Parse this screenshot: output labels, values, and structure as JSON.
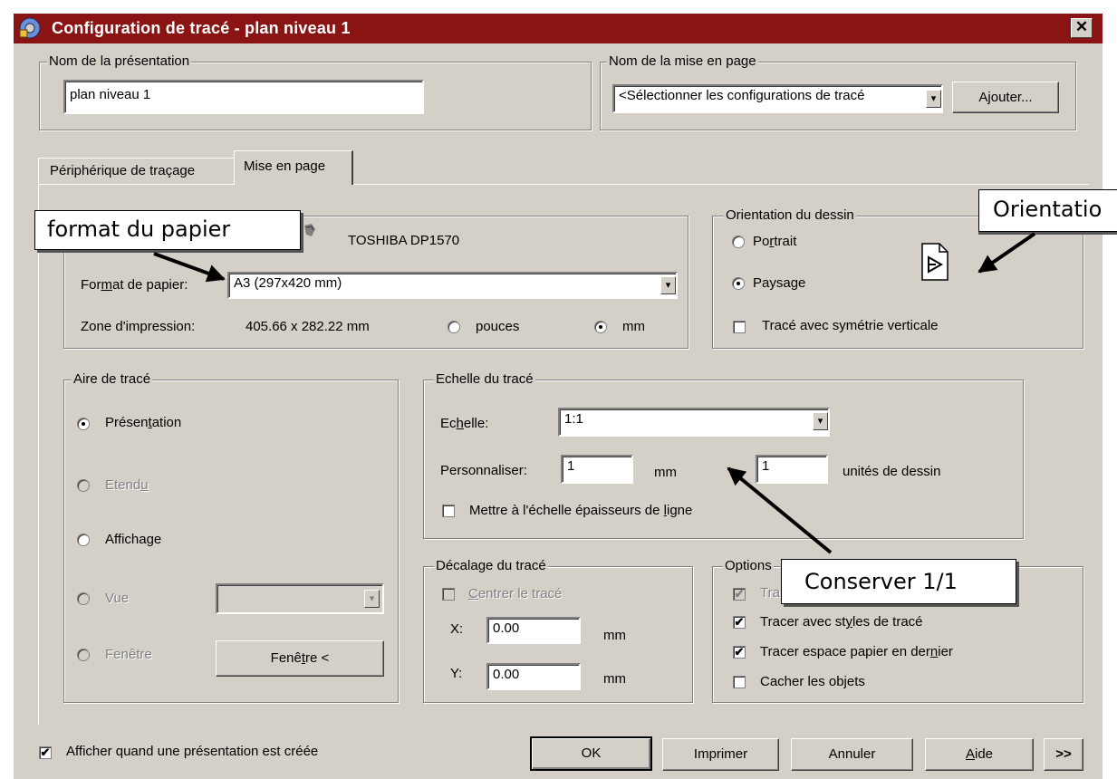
{
  "window": {
    "title": "Configuration de tracé - plan niveau 1",
    "close_glyph": "✕"
  },
  "layout_name": {
    "legend": "Nom de la présentation",
    "value": "plan niveau 1"
  },
  "page_setup_name": {
    "legend": "Nom de la mise en page",
    "value": "<Sélectionner les configurations de tracé",
    "add_button": "Ajouter..."
  },
  "tabs": [
    {
      "label": "Périphérique de traçage"
    },
    {
      "label": "Mise en page"
    }
  ],
  "paper": {
    "printer": "TOSHIBA DP1570",
    "format_label": "Format de papier:",
    "format_value": "A3 (297x420 mm)",
    "area_label": "Zone d'impression:",
    "area_value": "405.66 x 282.22 mm",
    "units": [
      {
        "label": "pouces",
        "selected": false
      },
      {
        "label": "mm",
        "selected": true
      }
    ]
  },
  "orientation": {
    "legend": "Orientation du dessin",
    "options": [
      {
        "label": "Portrait",
        "selected": false
      },
      {
        "label": "Paysage",
        "selected": true
      }
    ],
    "mirror_label": "Tracé avec symétrie verticale",
    "mirror_checked": false
  },
  "plot_area": {
    "legend": "Aire de tracé",
    "options": [
      {
        "label": "Présentation",
        "selected": true,
        "enabled": true
      },
      {
        "label": "Etendu",
        "selected": false,
        "enabled": false
      },
      {
        "label": "Affichage",
        "selected": false,
        "enabled": true
      },
      {
        "label": "Vue",
        "selected": false,
        "enabled": false
      },
      {
        "label": "Fenêtre",
        "selected": false,
        "enabled": false
      }
    ],
    "window_button": "Fenêtre <"
  },
  "plot_scale": {
    "legend": "Echelle du tracé",
    "scale_label": "Echelle:",
    "scale_value": "1:1",
    "custom_label": "Personnaliser:",
    "custom_mm": "1",
    "mm_unit": "mm",
    "equals": "=",
    "custom_units": "1",
    "units_label": "unités de dessin",
    "lineweights_label": "Mettre à l'échelle épaisseurs de ligne",
    "lineweights_checked": false
  },
  "plot_offset": {
    "legend": "Décalage du tracé",
    "center_label": "Centrer le tracé",
    "x_label": "X:",
    "x_value": "0.00",
    "y_label": "Y:",
    "y_value": "0.00",
    "unit": "mm"
  },
  "plot_options": {
    "legend_visible": "Options",
    "items": [
      {
        "label": "Tra",
        "checked": true,
        "enabled": false
      },
      {
        "label": "Tracer avec styles de tracé",
        "checked": true,
        "enabled": true
      },
      {
        "label": "Tracer espace papier en dernier",
        "checked": true,
        "enabled": true
      },
      {
        "label": "Cacher les objets",
        "checked": false,
        "enabled": true
      }
    ]
  },
  "footer": {
    "show_label": "Afficher quand une présentation est créée",
    "show_checked": true,
    "ok": "OK",
    "print": "Imprimer",
    "cancel": "Annuler",
    "help": "Aide",
    "more": ">>"
  },
  "annotations": {
    "paper_format": "format du papier",
    "orientation": "Orientatio",
    "keep_scale": "Conserver 1/1"
  },
  "check_glyph": "✔"
}
